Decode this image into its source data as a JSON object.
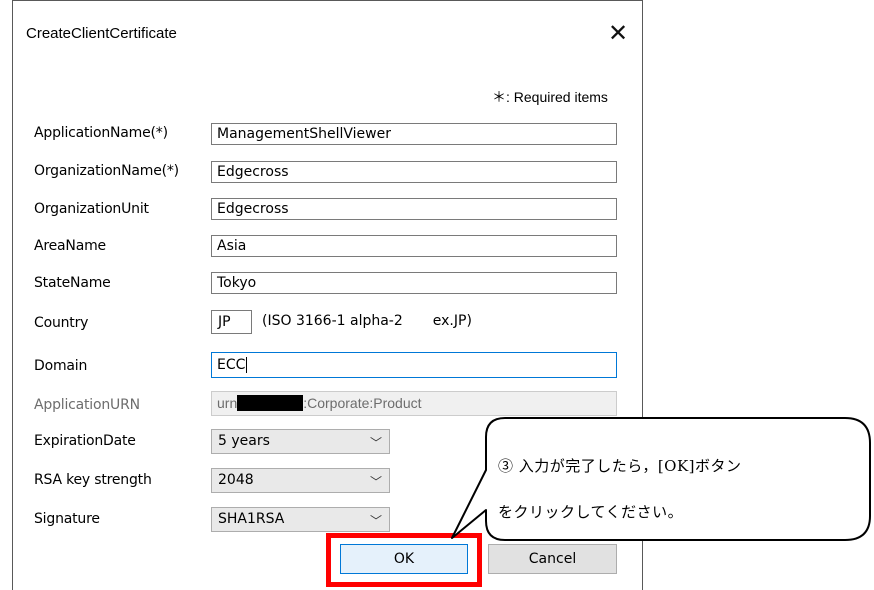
{
  "window": {
    "title": "CreateClientCertificate",
    "close_glyph": "✕"
  },
  "required_note": "＊: Required items",
  "fields": {
    "application_name": {
      "label": "ApplicationName(*)",
      "value": "ManagementShellViewer"
    },
    "organization_name": {
      "label": "OrganizationName(*)",
      "value": "Edgecross"
    },
    "organization_unit": {
      "label": "OrganizationUnit",
      "value": "Edgecross"
    },
    "area_name": {
      "label": "AreaName",
      "value": "Asia"
    },
    "state_name": {
      "label": "StateName",
      "value": "Tokyo"
    },
    "country": {
      "label": "Country",
      "value": "JP",
      "hint": "(ISO 3166-1 alpha-2",
      "hint_example": "ex.JP)"
    },
    "domain": {
      "label": "Domain",
      "value": "ECC"
    },
    "application_urn": {
      "label": "ApplicationURN",
      "value_prefix": "urn",
      "value_suffix": ":Corporate:Product"
    }
  },
  "selects": {
    "expiration_date": {
      "label": "ExpirationDate",
      "value": "5 years"
    },
    "rsa_key_strength": {
      "label": "RSA key strength",
      "value": "2048"
    },
    "signature": {
      "label": "Signature",
      "value": "SHA1RSA"
    }
  },
  "buttons": {
    "ok": "OK",
    "cancel": "Cancel"
  },
  "callout": {
    "line1": "③ 入力が完了したら，[OK]ボタン",
    "line2": "をクリックしてください。"
  },
  "colors": {
    "highlight": "#ff0000",
    "focus_border": "#0078d7"
  }
}
